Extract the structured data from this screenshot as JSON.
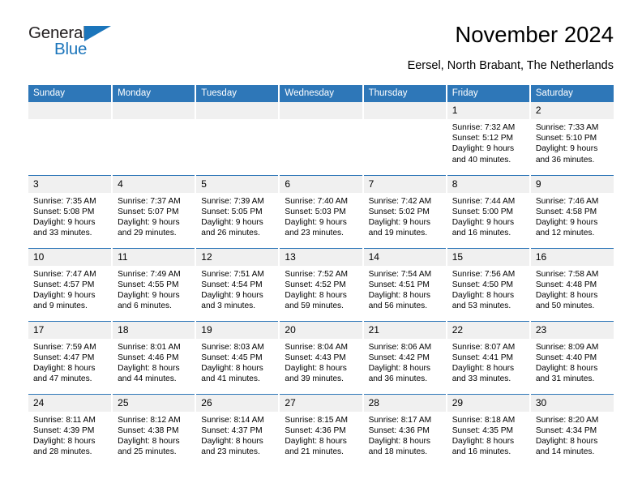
{
  "brand": {
    "name_part1": "General",
    "name_part2": "Blue",
    "accent_color": "#1B75BB"
  },
  "header": {
    "title": "November 2024",
    "subtitle": "Eersel, North Brabant, The Netherlands"
  },
  "calendar": {
    "header_bg": "#2E77B8",
    "daynum_bg": "#F0F0F0",
    "weekday_labels": [
      "Sunday",
      "Monday",
      "Tuesday",
      "Wednesday",
      "Thursday",
      "Friday",
      "Saturday"
    ],
    "weeks": [
      [
        {
          "day": "",
          "lines": []
        },
        {
          "day": "",
          "lines": []
        },
        {
          "day": "",
          "lines": []
        },
        {
          "day": "",
          "lines": []
        },
        {
          "day": "",
          "lines": []
        },
        {
          "day": "1",
          "lines": [
            "Sunrise: 7:32 AM",
            "Sunset: 5:12 PM",
            "Daylight: 9 hours",
            "and 40 minutes."
          ]
        },
        {
          "day": "2",
          "lines": [
            "Sunrise: 7:33 AM",
            "Sunset: 5:10 PM",
            "Daylight: 9 hours",
            "and 36 minutes."
          ]
        }
      ],
      [
        {
          "day": "3",
          "lines": [
            "Sunrise: 7:35 AM",
            "Sunset: 5:08 PM",
            "Daylight: 9 hours",
            "and 33 minutes."
          ]
        },
        {
          "day": "4",
          "lines": [
            "Sunrise: 7:37 AM",
            "Sunset: 5:07 PM",
            "Daylight: 9 hours",
            "and 29 minutes."
          ]
        },
        {
          "day": "5",
          "lines": [
            "Sunrise: 7:39 AM",
            "Sunset: 5:05 PM",
            "Daylight: 9 hours",
            "and 26 minutes."
          ]
        },
        {
          "day": "6",
          "lines": [
            "Sunrise: 7:40 AM",
            "Sunset: 5:03 PM",
            "Daylight: 9 hours",
            "and 23 minutes."
          ]
        },
        {
          "day": "7",
          "lines": [
            "Sunrise: 7:42 AM",
            "Sunset: 5:02 PM",
            "Daylight: 9 hours",
            "and 19 minutes."
          ]
        },
        {
          "day": "8",
          "lines": [
            "Sunrise: 7:44 AM",
            "Sunset: 5:00 PM",
            "Daylight: 9 hours",
            "and 16 minutes."
          ]
        },
        {
          "day": "9",
          "lines": [
            "Sunrise: 7:46 AM",
            "Sunset: 4:58 PM",
            "Daylight: 9 hours",
            "and 12 minutes."
          ]
        }
      ],
      [
        {
          "day": "10",
          "lines": [
            "Sunrise: 7:47 AM",
            "Sunset: 4:57 PM",
            "Daylight: 9 hours",
            "and 9 minutes."
          ]
        },
        {
          "day": "11",
          "lines": [
            "Sunrise: 7:49 AM",
            "Sunset: 4:55 PM",
            "Daylight: 9 hours",
            "and 6 minutes."
          ]
        },
        {
          "day": "12",
          "lines": [
            "Sunrise: 7:51 AM",
            "Sunset: 4:54 PM",
            "Daylight: 9 hours",
            "and 3 minutes."
          ]
        },
        {
          "day": "13",
          "lines": [
            "Sunrise: 7:52 AM",
            "Sunset: 4:52 PM",
            "Daylight: 8 hours",
            "and 59 minutes."
          ]
        },
        {
          "day": "14",
          "lines": [
            "Sunrise: 7:54 AM",
            "Sunset: 4:51 PM",
            "Daylight: 8 hours",
            "and 56 minutes."
          ]
        },
        {
          "day": "15",
          "lines": [
            "Sunrise: 7:56 AM",
            "Sunset: 4:50 PM",
            "Daylight: 8 hours",
            "and 53 minutes."
          ]
        },
        {
          "day": "16",
          "lines": [
            "Sunrise: 7:58 AM",
            "Sunset: 4:48 PM",
            "Daylight: 8 hours",
            "and 50 minutes."
          ]
        }
      ],
      [
        {
          "day": "17",
          "lines": [
            "Sunrise: 7:59 AM",
            "Sunset: 4:47 PM",
            "Daylight: 8 hours",
            "and 47 minutes."
          ]
        },
        {
          "day": "18",
          "lines": [
            "Sunrise: 8:01 AM",
            "Sunset: 4:46 PM",
            "Daylight: 8 hours",
            "and 44 minutes."
          ]
        },
        {
          "day": "19",
          "lines": [
            "Sunrise: 8:03 AM",
            "Sunset: 4:45 PM",
            "Daylight: 8 hours",
            "and 41 minutes."
          ]
        },
        {
          "day": "20",
          "lines": [
            "Sunrise: 8:04 AM",
            "Sunset: 4:43 PM",
            "Daylight: 8 hours",
            "and 39 minutes."
          ]
        },
        {
          "day": "21",
          "lines": [
            "Sunrise: 8:06 AM",
            "Sunset: 4:42 PM",
            "Daylight: 8 hours",
            "and 36 minutes."
          ]
        },
        {
          "day": "22",
          "lines": [
            "Sunrise: 8:07 AM",
            "Sunset: 4:41 PM",
            "Daylight: 8 hours",
            "and 33 minutes."
          ]
        },
        {
          "day": "23",
          "lines": [
            "Sunrise: 8:09 AM",
            "Sunset: 4:40 PM",
            "Daylight: 8 hours",
            "and 31 minutes."
          ]
        }
      ],
      [
        {
          "day": "24",
          "lines": [
            "Sunrise: 8:11 AM",
            "Sunset: 4:39 PM",
            "Daylight: 8 hours",
            "and 28 minutes."
          ]
        },
        {
          "day": "25",
          "lines": [
            "Sunrise: 8:12 AM",
            "Sunset: 4:38 PM",
            "Daylight: 8 hours",
            "and 25 minutes."
          ]
        },
        {
          "day": "26",
          "lines": [
            "Sunrise: 8:14 AM",
            "Sunset: 4:37 PM",
            "Daylight: 8 hours",
            "and 23 minutes."
          ]
        },
        {
          "day": "27",
          "lines": [
            "Sunrise: 8:15 AM",
            "Sunset: 4:36 PM",
            "Daylight: 8 hours",
            "and 21 minutes."
          ]
        },
        {
          "day": "28",
          "lines": [
            "Sunrise: 8:17 AM",
            "Sunset: 4:36 PM",
            "Daylight: 8 hours",
            "and 18 minutes."
          ]
        },
        {
          "day": "29",
          "lines": [
            "Sunrise: 8:18 AM",
            "Sunset: 4:35 PM",
            "Daylight: 8 hours",
            "and 16 minutes."
          ]
        },
        {
          "day": "30",
          "lines": [
            "Sunrise: 8:20 AM",
            "Sunset: 4:34 PM",
            "Daylight: 8 hours",
            "and 14 minutes."
          ]
        }
      ]
    ]
  }
}
